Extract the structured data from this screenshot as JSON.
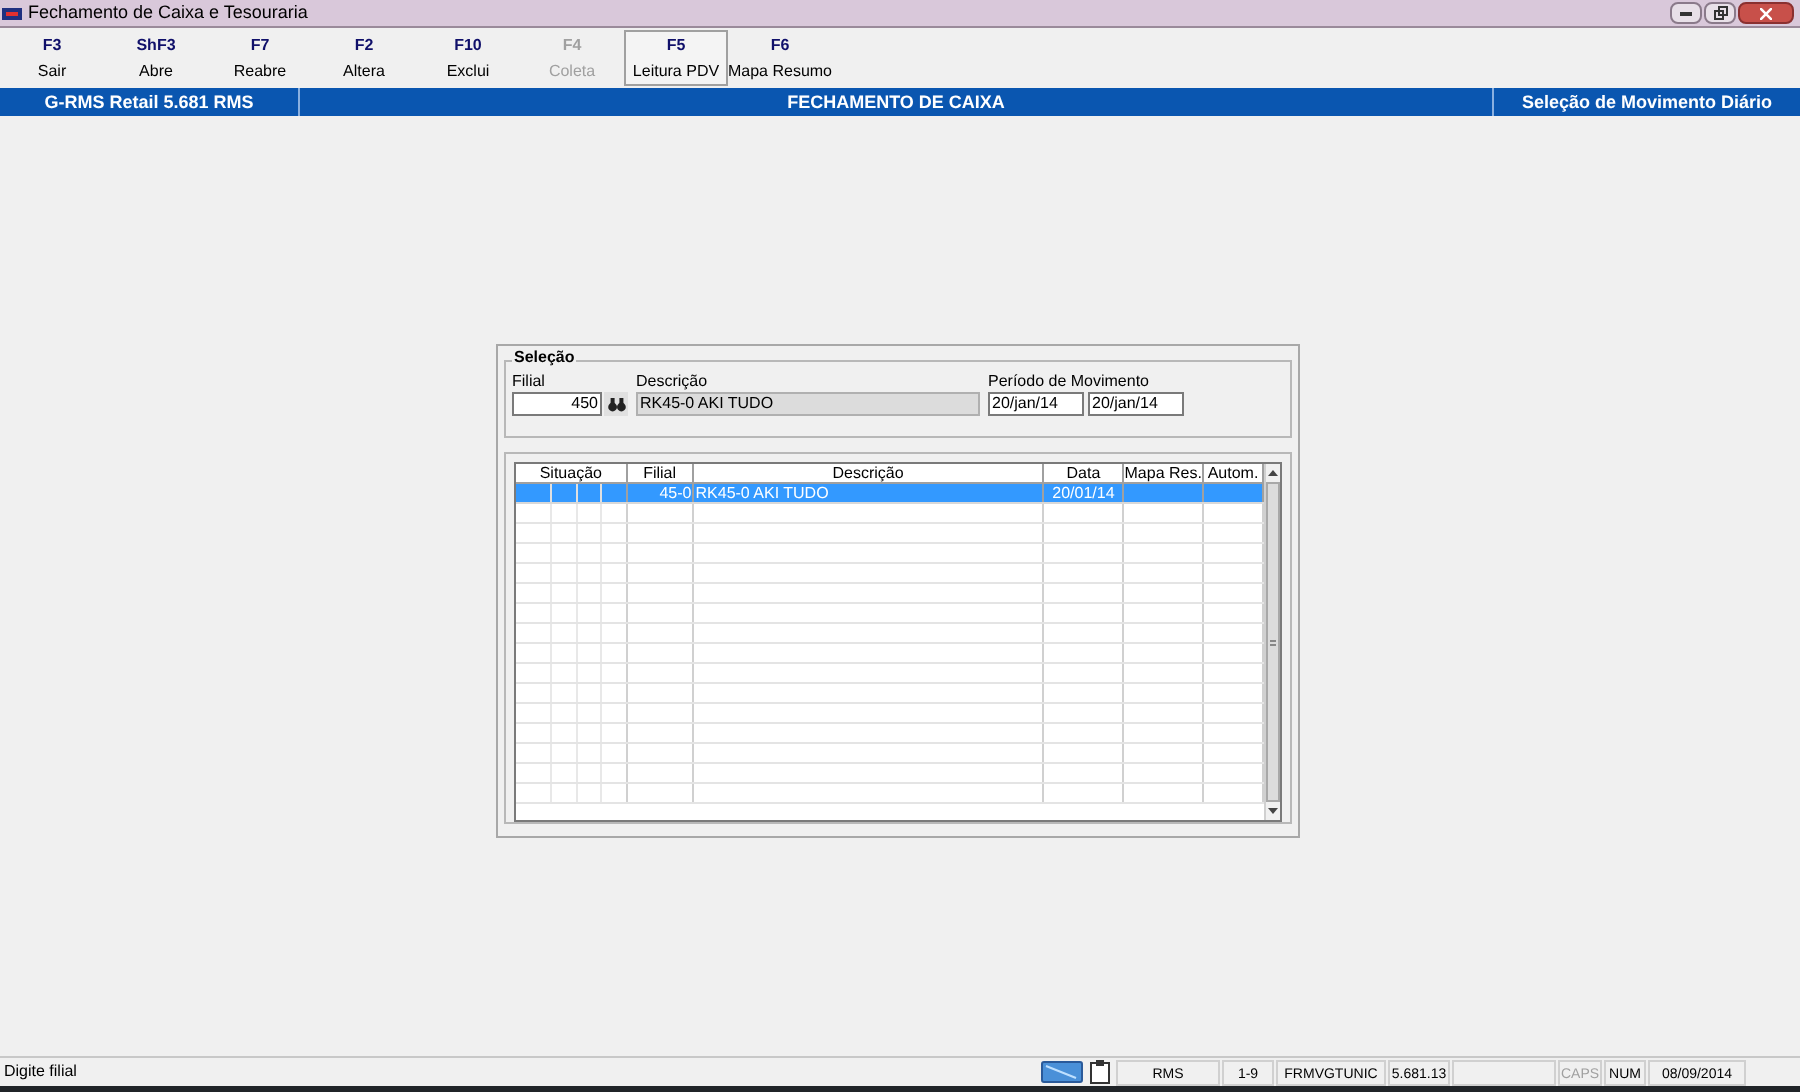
{
  "window": {
    "title": "Fechamento de Caixa e Tesouraria"
  },
  "toolbar": [
    {
      "key": "F3",
      "label": "Sair",
      "disabled": false,
      "selected": false
    },
    {
      "key": "ShF3",
      "label": "Abre",
      "disabled": false,
      "selected": false
    },
    {
      "key": "F7",
      "label": "Reabre",
      "disabled": false,
      "selected": false
    },
    {
      "key": "F2",
      "label": "Altera",
      "disabled": false,
      "selected": false
    },
    {
      "key": "F10",
      "label": "Exclui",
      "disabled": false,
      "selected": false
    },
    {
      "key": "F4",
      "label": "Coleta",
      "disabled": true,
      "selected": false
    },
    {
      "key": "F5",
      "label": "Leitura PDV",
      "disabled": false,
      "selected": true
    },
    {
      "key": "F6",
      "label": "Mapa Resumo",
      "disabled": false,
      "selected": false
    }
  ],
  "header": {
    "system": "G-RMS Retail 5.681 RMS",
    "module": "FECHAMENTO DE CAIXA",
    "screen": "Seleção de Movimento Diário"
  },
  "selection": {
    "legend": "Seleção",
    "filial_label": "Filial",
    "filial_value": "450",
    "descricao_label": "Descrição",
    "descricao_value": "RK45-0 AKI TUDO",
    "periodo_label": "Período de Movimento",
    "date_from": "20/jan/14",
    "date_to": "20/jan/14"
  },
  "table": {
    "columns": [
      "Situação",
      "Filial",
      "Descrição",
      "Data",
      "Mapa Res.",
      "Autom."
    ],
    "rows": [
      {
        "filial": "45-0",
        "descricao": "RK45-0 AKI TUDO",
        "data": "20/01/14",
        "selected": true
      }
    ]
  },
  "status_bar": {
    "message": "Digite filial",
    "panels": [
      {
        "kind": "text",
        "text": "RMS",
        "disabled": false
      },
      {
        "kind": "text",
        "text": "1-9",
        "disabled": false
      },
      {
        "kind": "text",
        "text": "FRMVGTUNIC",
        "disabled": false
      },
      {
        "kind": "text",
        "text": "5.681.13",
        "disabled": false
      },
      {
        "kind": "blank"
      },
      {
        "kind": "text",
        "text": "CAPS",
        "disabled": true
      },
      {
        "kind": "text",
        "text": "NUM",
        "disabled": false
      },
      {
        "kind": "text",
        "text": "08/09/2014",
        "disabled": false
      }
    ]
  }
}
